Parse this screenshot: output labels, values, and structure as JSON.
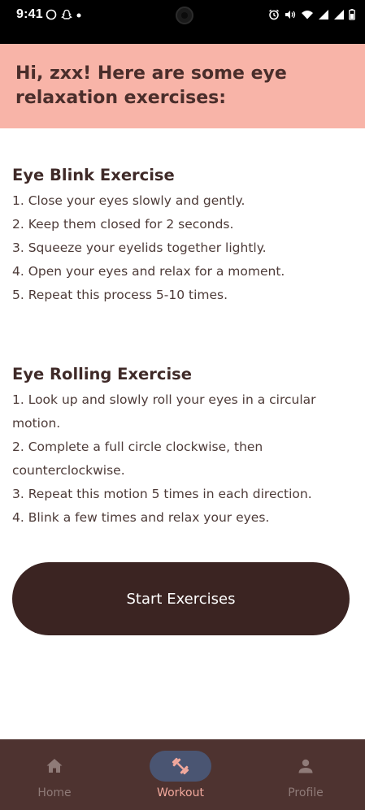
{
  "status_bar": {
    "time": "9:41"
  },
  "header": {
    "greeting": "Hi, zxx! Here are some eye relaxation exercises:"
  },
  "exercises": [
    {
      "title": "Eye Blink Exercise",
      "steps": [
        "1. Close your eyes slowly and gently.",
        "2. Keep them closed for 2 seconds.",
        "3. Squeeze your eyelids together lightly.",
        "4. Open your eyes and relax for a moment.",
        "5. Repeat this process 5-10 times."
      ]
    },
    {
      "title": "Eye Rolling Exercise",
      "steps": [
        "1. Look up and slowly roll your eyes in a circular motion.",
        "2. Complete a full circle clockwise, then counterclockwise.",
        "3. Repeat this motion 5 times in each direction.",
        "4. Blink a few times and relax your eyes."
      ]
    }
  ],
  "start_button": {
    "label": "Start Exercises"
  },
  "bottom_nav": {
    "items": [
      {
        "label": "Home",
        "icon": "home-icon"
      },
      {
        "label": "Workout",
        "icon": "dumbbell-icon",
        "active": true
      },
      {
        "label": "Profile",
        "icon": "person-icon"
      }
    ]
  },
  "colors": {
    "header_bg": "#f8b4a8",
    "button_bg": "#3b2422",
    "nav_bg": "#4e3330",
    "nav_active_pill": "#4a5572",
    "nav_active_label": "#f2a99d"
  }
}
